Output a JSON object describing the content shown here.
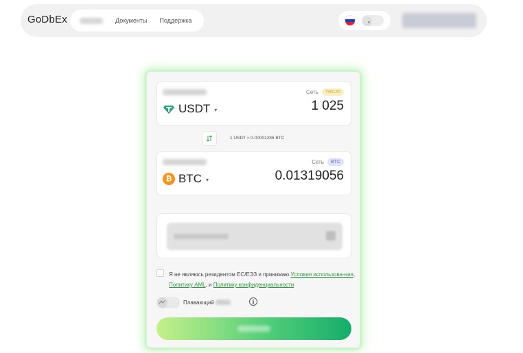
{
  "header": {
    "logo": "GoDbEx",
    "nav": [
      {
        "label": "Документы"
      },
      {
        "label": "Поддержка"
      }
    ],
    "colors": {
      "flag_white": "#ffffff",
      "flag_blue": "#1c3fc9",
      "flag_red": "#e0212b"
    }
  },
  "exchange": {
    "from": {
      "coin": "USDT",
      "network_label": "Сеть",
      "network": "TRC20",
      "amount": "1 025",
      "icon": "tether-icon",
      "icon_color": "#26a17b",
      "badge_bg": "#fbf0c4",
      "badge_color": "#c4a335"
    },
    "rate": "1 USDT ≈ 0.00001286 BTC",
    "to": {
      "coin": "BTC",
      "network_label": "Сеть",
      "network": "BTC",
      "amount": "0.01319056",
      "icon": "bitcoin-icon",
      "icon_color": "#f7931a",
      "badge_bg": "#dfe2f9",
      "badge_color": "#5c66c3"
    },
    "agreement": {
      "prefix": "Я не являюсь резидентом ЕС/ЕЭЗ и принимаю ",
      "terms": "Условия использова-ния",
      "sep1": ", ",
      "aml": "Политику AML",
      "sep2": ", и ",
      "privacy": "Политику конфиденциальности"
    },
    "floating_label": "Плавающий",
    "accent_green": "#2f9a3f"
  }
}
